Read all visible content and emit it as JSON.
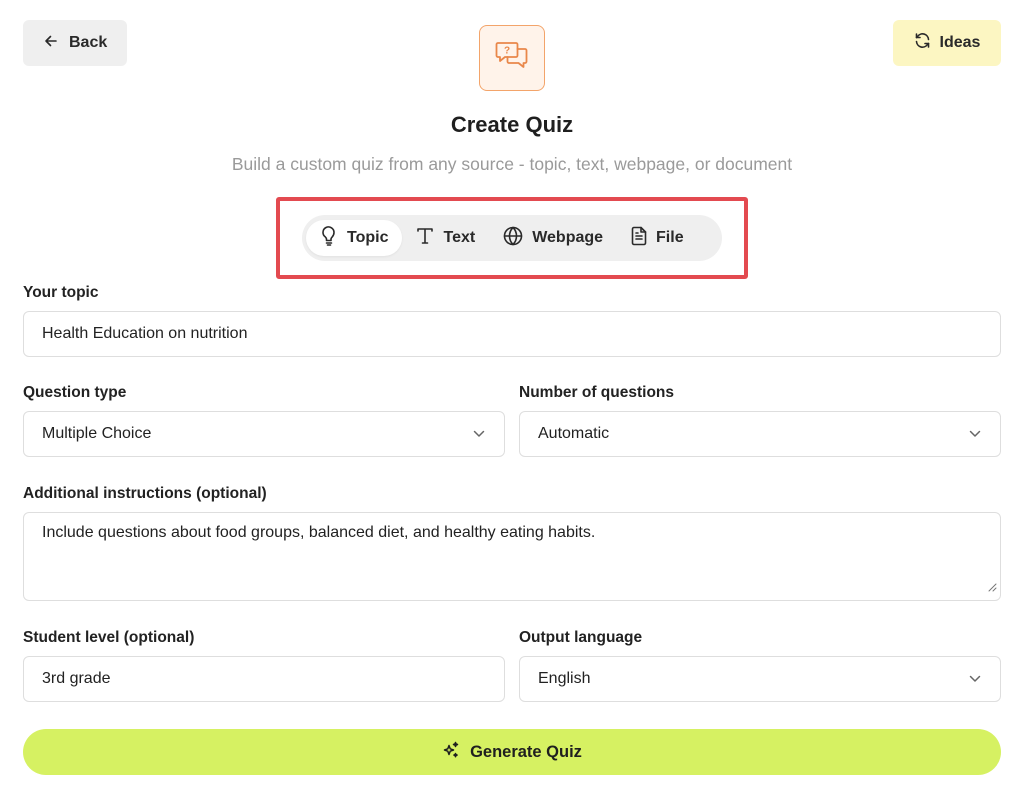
{
  "header": {
    "back_label": "Back",
    "ideas_label": "Ideas",
    "title": "Create Quiz",
    "subtitle": "Build a custom quiz from any source - topic, text, webpage, or document"
  },
  "tabs": [
    {
      "label": "Topic",
      "icon": "lightbulb-icon",
      "active": true
    },
    {
      "label": "Text",
      "icon": "text-icon",
      "active": false
    },
    {
      "label": "Webpage",
      "icon": "globe-icon",
      "active": false
    },
    {
      "label": "File",
      "icon": "file-icon",
      "active": false
    }
  ],
  "form": {
    "topic": {
      "label": "Your topic",
      "value": "Health Education on nutrition"
    },
    "question_type": {
      "label": "Question type",
      "value": "Multiple Choice"
    },
    "num_questions": {
      "label": "Number of questions",
      "value": "Automatic"
    },
    "instructions": {
      "label": "Additional instructions (optional)",
      "value": "Include questions about food groups, balanced diet, and healthy eating habits."
    },
    "student_level": {
      "label": "Student level (optional)",
      "value": "3rd grade"
    },
    "output_language": {
      "label": "Output language",
      "value": "English"
    }
  },
  "generate_label": "Generate Quiz",
  "colors": {
    "accent": "#d6f162",
    "ideas_bg": "#fcf6c2",
    "logo_border": "#f3a46a",
    "highlight": "#e34a50"
  }
}
